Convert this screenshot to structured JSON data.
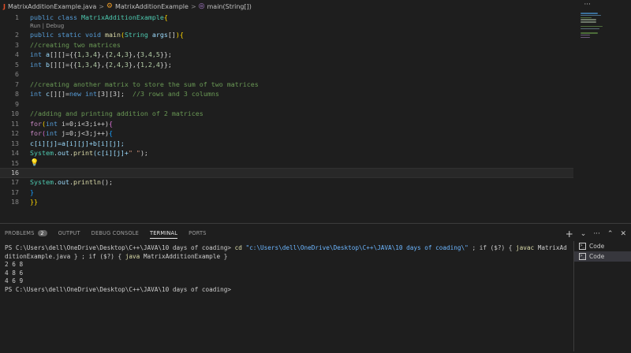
{
  "breadcrumb": {
    "file": "MatrixAdditionExample.java",
    "class_name": "MatrixAdditionExample",
    "method": "main(String[])",
    "sep": ">",
    "java_glyph": "J",
    "class_glyph": "⚙",
    "method_glyph": "◎",
    "more": "···"
  },
  "editor": {
    "codelens": "Run | Debug",
    "lines": [
      {
        "n": "1"
      },
      {
        "n": "2"
      },
      {
        "n": "3"
      },
      {
        "n": "4"
      },
      {
        "n": "5"
      },
      {
        "n": "6"
      },
      {
        "n": "7"
      },
      {
        "n": "8"
      },
      {
        "n": "9"
      },
      {
        "n": "10"
      },
      {
        "n": "11"
      },
      {
        "n": "12"
      },
      {
        "n": "13"
      },
      {
        "n": "14"
      },
      {
        "n": "15"
      },
      {
        "n": "16"
      },
      {
        "n": "17"
      },
      {
        "n": "18"
      }
    ],
    "code": {
      "l1_kw1": "public",
      "l1_kw2": "class",
      "l1_name": "MatrixAdditionExample",
      "l1_brace": "{",
      "l2_kw1": "public",
      "l2_kw2": "static",
      "l2_kw3": "void",
      "l2_fn": "main",
      "l2_paren1": "(",
      "l2_type": "String",
      "l2_arg": "args",
      "l2_rest": "[]",
      "l2_paren2": ")",
      "l2_brace": "{",
      "l3": "//creating two matrices",
      "l4_kw": "int",
      "l4_var": "a",
      "l4_rest1": "[][]={{",
      "l4_n": "1,3,4",
      "l4_m1": "},{",
      "l4_n2": "2,4,3",
      "l4_m2": "},{",
      "l4_n3": "3,4,5",
      "l4_end": "}};",
      "l5_kw": "int",
      "l5_var": "b",
      "l5_rest1": "[][]={{",
      "l5_n": "1,3,4",
      "l5_m1": "},{",
      "l5_n2": "2,4,3",
      "l5_m2": "},{",
      "l5_n3": "1,2,4",
      "l5_end": "}};",
      "l7": "//creating another matrix to store the sum of two matrices",
      "l8_kw": "int",
      "l8_var": "c",
      "l8_rest": "[][]=",
      "l8_new": "new",
      "l8_kw2": "int",
      "l8_dim": "[3][3];",
      "l8_cm": "//3 rows and 3 columns",
      "l10": "//adding and printing addition of 2 matrices",
      "l11_kw": "for",
      "l11_p1": "(",
      "l11_int": "int",
      "l11_rest": " i=0;i<3;i++)",
      "l11_brace": "{",
      "l12_kw": "for",
      "l12_p1": "(",
      "l12_int": "int",
      "l12_rest": " j=0;j<3;j++)",
      "l12_brace": "{",
      "l13": "c[i][j]=a[i][j]+b[i][j];",
      "l14_sys": "System",
      "l14_dot": ".",
      "l14_out": "out",
      "l14_dot2": ".",
      "l14_fn": "print",
      "l14_arg1": "(c[i][j]+",
      "l14_str": "\" \"",
      "l14_end": ");",
      "l16_sys": "System",
      "l16_dot": ".",
      "l16_out": "out",
      "l16_dot2": ".",
      "l16_fn": "println",
      "l16_end": "();",
      "l17": "}",
      "l18": "}}"
    },
    "bulb": "💡"
  },
  "panel": {
    "tabs": [
      {
        "label": "PROBLEMS"
      },
      {
        "label": "OUTPUT"
      },
      {
        "label": "DEBUG CONSOLE"
      },
      {
        "label": "TERMINAL"
      },
      {
        "label": "PORTS"
      }
    ],
    "problems_count": "2",
    "actions": {
      "add": "+",
      "dropdown": "⌄",
      "more": "···",
      "maximize": "⌃",
      "close": "✕"
    },
    "terminal": {
      "prompt1": "PS C:\\Users\\dell\\OneDrive\\Desktop\\C++\\JAVA\\10 days of coading> ",
      "cd": "cd ",
      "path_str": "\"c:\\Users\\dell\\OneDrive\\Desktop\\C++\\JAVA\\10 days of coading\\\"",
      "mid1": " ; if ($?) { ",
      "javac": "javac",
      "mid2": " MatrixAdditionExample.java } ; if ($?) { ",
      "java": "java",
      "mid3": " MatrixAdditionExample }",
      "out1": "2 6 8",
      "out2": "4 8 6",
      "out3": "4 6 9",
      "prompt2": "PS C:\\Users\\dell\\OneDrive\\Desktop\\C++\\JAVA\\10 days of coading>"
    },
    "terminal_list": [
      {
        "label": "Code"
      },
      {
        "label": "Code"
      }
    ],
    "term_glyph": ">_"
  }
}
